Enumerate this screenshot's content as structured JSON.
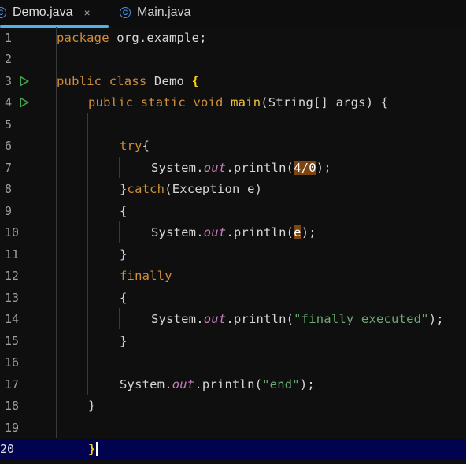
{
  "tabs": [
    {
      "label": "Demo.java",
      "icon": "class-icon",
      "active": true,
      "close": "×"
    },
    {
      "label": "Main.java",
      "icon": "class-icon",
      "active": false
    }
  ],
  "icon_glyph": "C",
  "lines": [
    {
      "n": "1"
    },
    {
      "n": "2"
    },
    {
      "n": "3"
    },
    {
      "n": "4"
    },
    {
      "n": "5"
    },
    {
      "n": "6"
    },
    {
      "n": "7"
    },
    {
      "n": "8"
    },
    {
      "n": "9"
    },
    {
      "n": "10"
    },
    {
      "n": "11"
    },
    {
      "n": "12"
    },
    {
      "n": "13"
    },
    {
      "n": "14"
    },
    {
      "n": "15"
    },
    {
      "n": "16"
    },
    {
      "n": "17"
    },
    {
      "n": "18"
    },
    {
      "n": "19"
    },
    {
      "n": "20"
    }
  ],
  "code": {
    "l1_kw": "package",
    "l1_rest": " org.example;",
    "l3_kw": "public class",
    "l3_name": " Demo ",
    "l3_brace": "{",
    "l4_kw": "public static void",
    "l4_fn": " main",
    "l4_rest": "(String[] args) {",
    "l6_kw": "try",
    "l6_rest": "{",
    "sys": "System.",
    "out": "out",
    "println": ".println(",
    "l7_arg": "4/0",
    "l7_end": ");",
    "l8_a": "}",
    "l8_kw": "catch",
    "l8_rest": "(Exception e)",
    "open": "{",
    "close": "}",
    "l10_arg": "e",
    "l10_end": ");",
    "l12_kw": "finally",
    "l14_str": "\"finally executed\"",
    "l14_end": ");",
    "l17_str": "\"end\"",
    "l17_end": ");",
    "l18": "}",
    "l20": "}"
  },
  "colors": {
    "keyword": "#cf8e3a",
    "method": "#56a8f5",
    "static_field": "#c77dbb",
    "string": "#6aab73",
    "current_line": "#02034f",
    "tab_underline": "#4fb2e8",
    "run_icon": "#3fa64a"
  }
}
